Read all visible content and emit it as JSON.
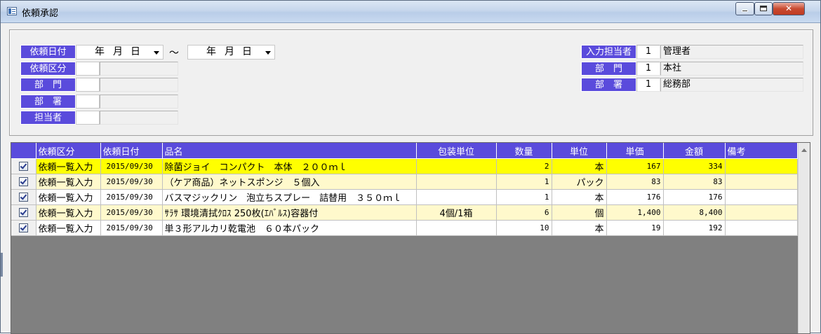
{
  "window": {
    "title": "依頼承認"
  },
  "filters": {
    "request_date_label": "依頼日付",
    "date_from": {
      "year": "年",
      "month": "月",
      "day": "日"
    },
    "range_sep": "～",
    "date_to": {
      "year": "年",
      "month": "月",
      "day": "日"
    },
    "request_type_label": "依頼区分",
    "department_label": "部　門",
    "section_label": "部　署",
    "person_label": "担当者"
  },
  "operator": {
    "entry_person_label": "入力担当者",
    "entry_person_code": "1",
    "entry_person_name": "管理者",
    "department_label": "部　門",
    "department_code": "1",
    "department_name": "本社",
    "section_label": "部　署",
    "section_code": "1",
    "section_name": "総務部"
  },
  "grid": {
    "columns": [
      "依頼区分",
      "依頼日付",
      "品名",
      "包装単位",
      "数量",
      "単位",
      "単価",
      "金額",
      "備考"
    ],
    "rows": [
      {
        "type": "依頼一覧入力",
        "date": "2015/09/30",
        "item": "除菌ジョイ　コンパクト　本体　２００ｍｌ",
        "pack": "",
        "qty": "2",
        "unit": "本",
        "price": "167",
        "amount": "334",
        "note": ""
      },
      {
        "type": "依頼一覧入力",
        "date": "2015/09/30",
        "item": "（ケア商品）ネットスポンジ　５個入",
        "pack": "",
        "qty": "1",
        "unit": "パック",
        "price": "83",
        "amount": "83",
        "note": ""
      },
      {
        "type": "依頼一覧入力",
        "date": "2015/09/30",
        "item": "バスマジックリン　泡立ちスプレー　詰替用　３５０ｍｌ",
        "pack": "",
        "qty": "1",
        "unit": "本",
        "price": "176",
        "amount": "176",
        "note": ""
      },
      {
        "type": "依頼一覧入力",
        "date": "2015/09/30",
        "item": "ｻﾗｻ 環境清拭ｸﾛｽ 250枚(ｴﾊﾞﾙｽ)容器付",
        "pack": "4個/1箱",
        "qty": "6",
        "unit": "個",
        "price": "1,400",
        "amount": "8,400",
        "note": ""
      },
      {
        "type": "依頼一覧入力",
        "date": "2015/09/30",
        "item": "単３形アルカリ乾電池　６０本パック",
        "pack": "",
        "qty": "10",
        "unit": "本",
        "price": "19",
        "amount": "192",
        "note": ""
      }
    ]
  },
  "colors": {
    "label_bg": "#5a4bdc",
    "selected_row": "#ffff00",
    "alt_row": "#fff9cc"
  }
}
